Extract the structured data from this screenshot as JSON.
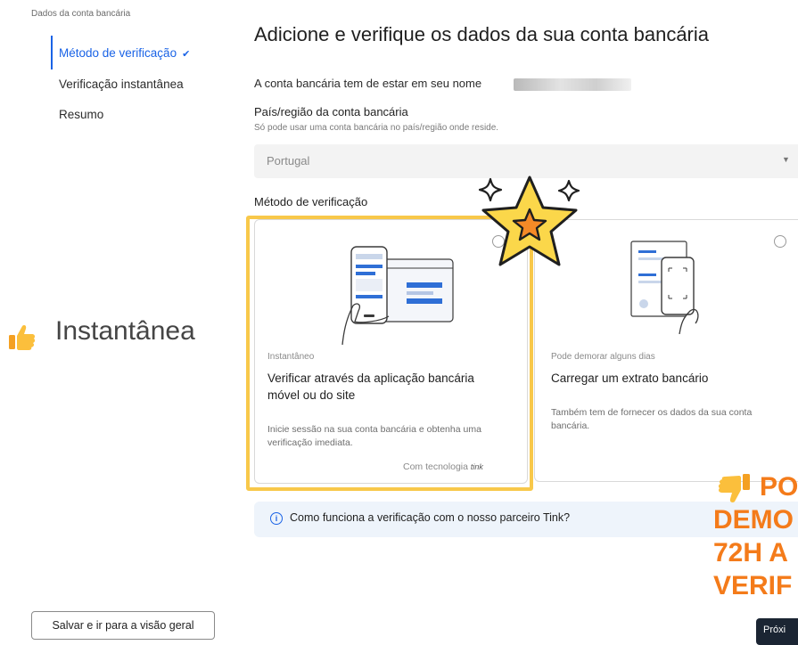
{
  "nav": {
    "section_title": "Dados da conta bancária",
    "items": [
      {
        "label": "Método de verificação",
        "active": true,
        "completed": true
      },
      {
        "label": "Verificação instantânea",
        "active": false
      },
      {
        "label": "Resumo",
        "active": false
      }
    ]
  },
  "main": {
    "title": "Adicione e verifique os dados da sua conta bancária",
    "owner_notice": "A conta bancária tem de estar em seu nome",
    "country": {
      "label": "País/região da conta bancária",
      "help": "Só pode usar uma conta bancária no país/região onde reside.",
      "selected": "Portugal"
    },
    "method_label": "Método de verificação",
    "methods": [
      {
        "kicker": "Instantâneo",
        "title": "Verificar através da aplicação bancária móvel ou do site",
        "description": "Inicie sessão na sua conta bancária e obtenha uma verificação imediata.",
        "footer": "Com tecnologia",
        "footer_brand": "tink",
        "selected": true
      },
      {
        "kicker": "Pode demorar alguns dias",
        "title": "Carregar um extrato bancário",
        "description": "Também tem de fornecer os dados da sua conta bancária.",
        "selected": false
      }
    ],
    "info_banner": "Como funciona a verificação com o nosso parceiro Tink?"
  },
  "footer": {
    "save_label": "Salvar e ir para a visão geral",
    "next_label": "Próxi"
  },
  "overlays": {
    "instant_label": "Instantânea",
    "negative_lines": [
      "PO",
      "DEMO",
      "72H A",
      "VERIF"
    ]
  },
  "colors": {
    "accent": "#1a63e6",
    "highlight": "#f8c84a",
    "overlay_orange": "#f47b1a",
    "next_button": "#1b2533",
    "info_bg": "#eef4fb"
  },
  "icons": [
    "check-icon",
    "chevron-down-icon",
    "info-icon",
    "thumbs-up-icon",
    "thumbs-down-icon",
    "star-icon",
    "sparkle-icon",
    "phone-bank-illustration",
    "document-upload-illustration"
  ]
}
